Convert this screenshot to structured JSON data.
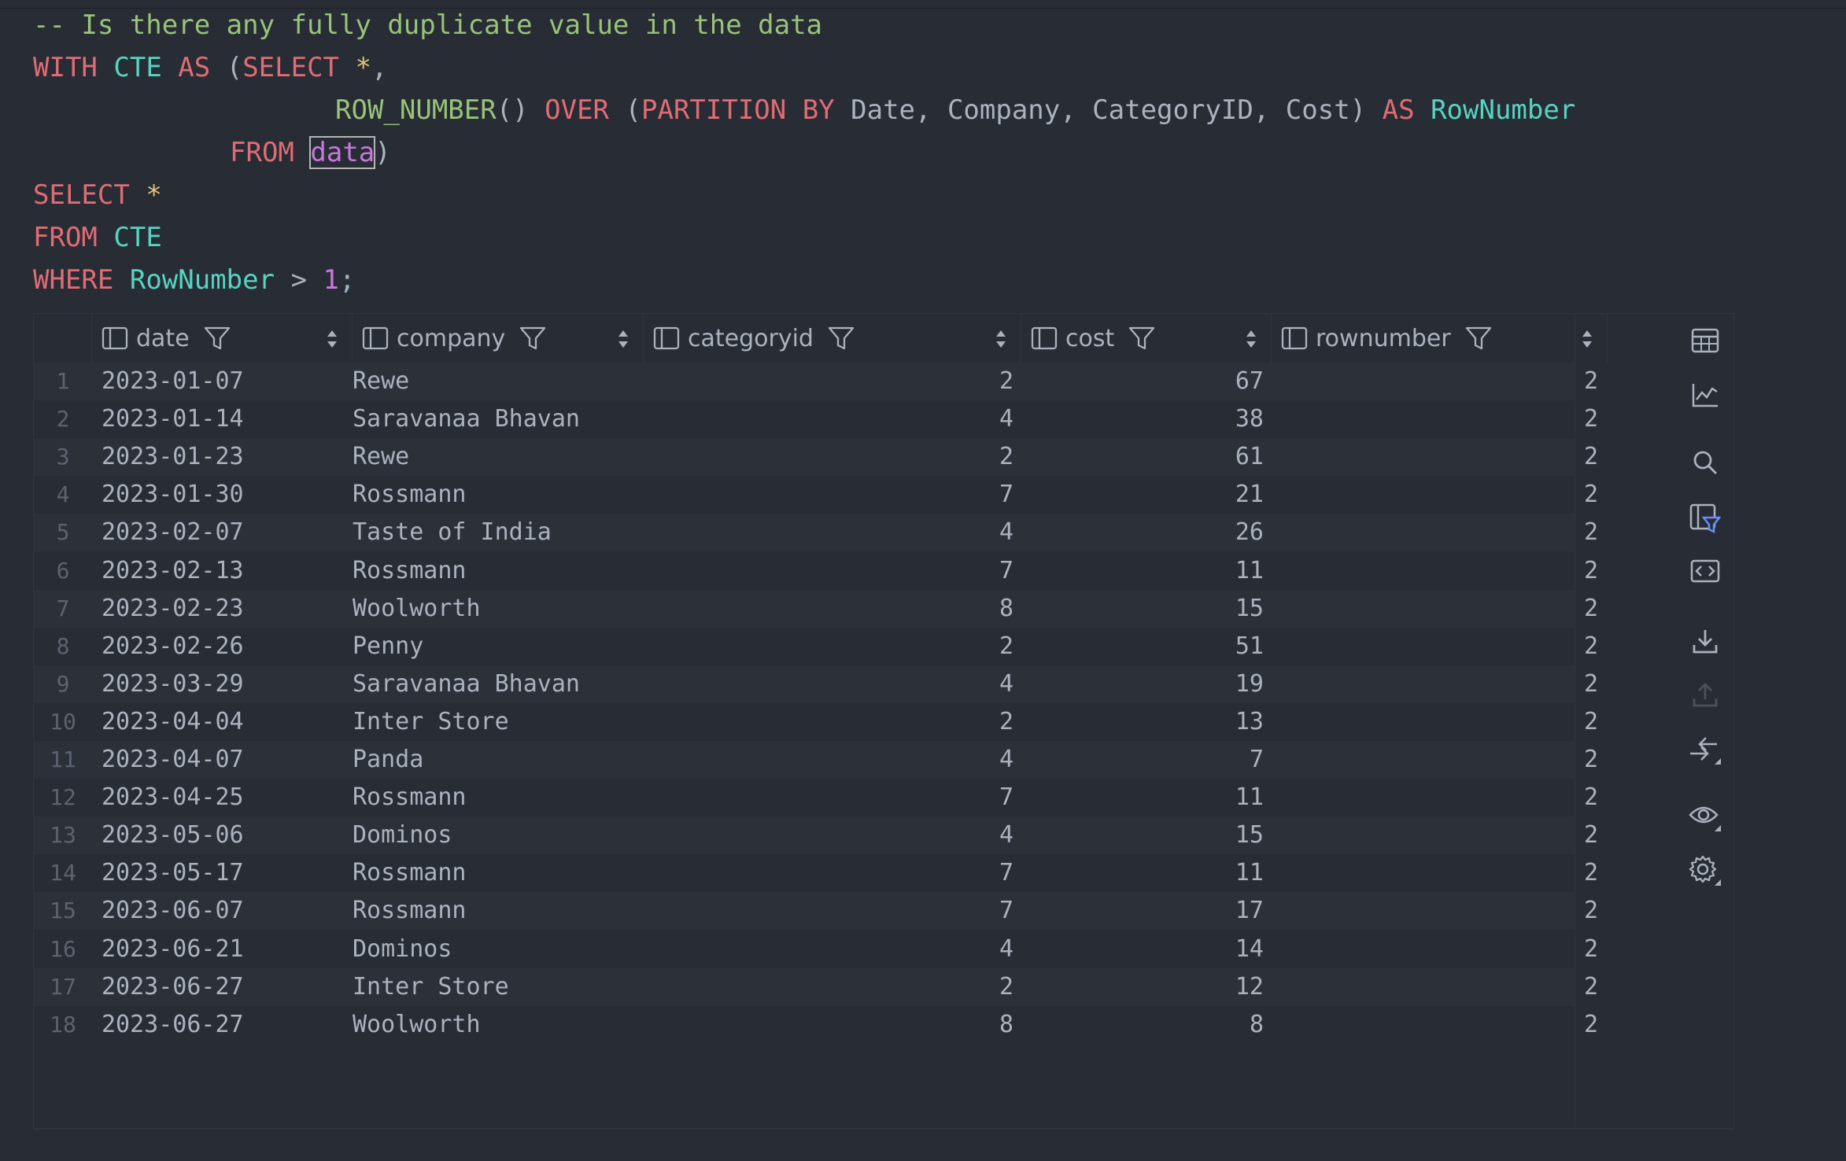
{
  "editor": {
    "line1": "-- Is there any fully duplicate value in the data",
    "line2": {
      "with": "WITH",
      "cte": "CTE",
      "as": "AS",
      "paren": "(",
      "select": "SELECT",
      "star": "*",
      "comma": ","
    },
    "line3": {
      "fn": "ROW_NUMBER",
      "parens": "()",
      "over": "OVER",
      "open": "(",
      "partition": "PARTITION BY",
      "cols": "Date, Company, CategoryID, Cost)",
      "as": "AS",
      "alias": "RowNumber"
    },
    "line4": {
      "from": "FROM",
      "table": "data",
      "close": ")"
    },
    "line5": {
      "select": "SELECT",
      "star": "*"
    },
    "line6": {
      "from": "FROM",
      "cte": "CTE"
    },
    "line7": {
      "where": "WHERE",
      "col": "RowNumber",
      "op": ">",
      "num": "1",
      "semi": ";"
    }
  },
  "table": {
    "columns": [
      "date",
      "company",
      "categoryid",
      "cost",
      "rownumber"
    ],
    "rows": [
      [
        "1",
        "2023-01-07",
        "Rewe",
        "2",
        "67",
        "2"
      ],
      [
        "2",
        "2023-01-14",
        "Saravanaa Bhavan",
        "4",
        "38",
        "2"
      ],
      [
        "3",
        "2023-01-23",
        "Rewe",
        "2",
        "61",
        "2"
      ],
      [
        "4",
        "2023-01-30",
        "Rossmann",
        "7",
        "21",
        "2"
      ],
      [
        "5",
        "2023-02-07",
        "Taste of India",
        "4",
        "26",
        "2"
      ],
      [
        "6",
        "2023-02-13",
        "Rossmann",
        "7",
        "11",
        "2"
      ],
      [
        "7",
        "2023-02-23",
        "Woolworth",
        "8",
        "15",
        "2"
      ],
      [
        "8",
        "2023-02-26",
        "Penny",
        "2",
        "51",
        "2"
      ],
      [
        "9",
        "2023-03-29",
        "Saravanaa Bhavan",
        "4",
        "19",
        "2"
      ],
      [
        "10",
        "2023-04-04",
        "Inter Store",
        "2",
        "13",
        "2"
      ],
      [
        "11",
        "2023-04-07",
        "Panda",
        "4",
        "7",
        "2"
      ],
      [
        "12",
        "2023-04-25",
        "Rossmann",
        "7",
        "11",
        "2"
      ],
      [
        "13",
        "2023-05-06",
        "Dominos",
        "4",
        "15",
        "2"
      ],
      [
        "14",
        "2023-05-17",
        "Rossmann",
        "7",
        "11",
        "2"
      ],
      [
        "15",
        "2023-06-07",
        "Rossmann",
        "7",
        "17",
        "2"
      ],
      [
        "16",
        "2023-06-21",
        "Dominos",
        "4",
        "14",
        "2"
      ],
      [
        "17",
        "2023-06-27",
        "Inter Store",
        "2",
        "12",
        "2"
      ],
      [
        "18",
        "2023-06-27",
        "Woolworth",
        "8",
        "8",
        "2"
      ]
    ]
  },
  "side_toolbar": [
    "table-view-icon",
    "chart-view-icon",
    "search-icon",
    "filter-columns-icon",
    "code-view-icon",
    "download-icon",
    "upload-icon",
    "collapse-icon",
    "preview-icon",
    "settings-icon"
  ],
  "colors": {
    "background": "#282c34",
    "keyword": "#e06c75",
    "identifier": "#56d4c2",
    "comment": "#98c379",
    "number": "#c678dd",
    "filter_accent": "#6b8cff"
  }
}
